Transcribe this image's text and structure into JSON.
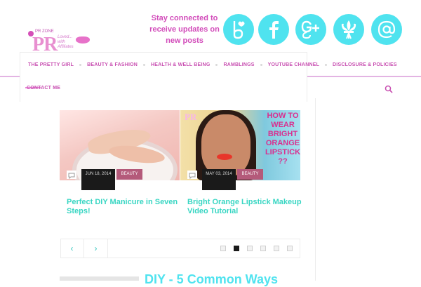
{
  "header": {
    "logo": {
      "text": "PR",
      "small_text": "PR ZONE",
      "tagline": "Loved... with Affiliates"
    },
    "connect_text": "Stay connected to receive updates on new posts",
    "social_icons": [
      "bloglovin-icon",
      "facebook-icon",
      "google-plus-icon",
      "fleur-de-lis-icon",
      "email-icon"
    ],
    "colors": {
      "accent": "#d24cba",
      "social_bg": "#4fe3ef",
      "teal_text": "#39d6c3"
    }
  },
  "nav": {
    "items": [
      "THE PRETTY GIRL",
      "BEAUTY & FASHION",
      "HEALTH & WELL BEING",
      "RAMBLINGS",
      "YOUTUBE CHANNEL",
      "DISCLOSURE & POLICIES"
    ],
    "contact": "CONTACT ME"
  },
  "slides": [
    {
      "date": "JUN 18, 2014",
      "category": "BEAUTY",
      "title": "Perfect DIY Manicure in Seven Steps!"
    },
    {
      "date": "MAY 03, 2014",
      "category": "BEAUTY",
      "title": "Bright Orange Lipstick Makeup Video Tutorial",
      "image_text": "HOW TO WEAR BRIGHT ORANGE LIPSTICK ??",
      "image_mark": "PR"
    }
  ],
  "slider": {
    "prev": "‹",
    "next": "›",
    "pages": 6,
    "active_page": 2
  },
  "next_post": {
    "title_peek": "DIY - 5 Common Ways"
  }
}
